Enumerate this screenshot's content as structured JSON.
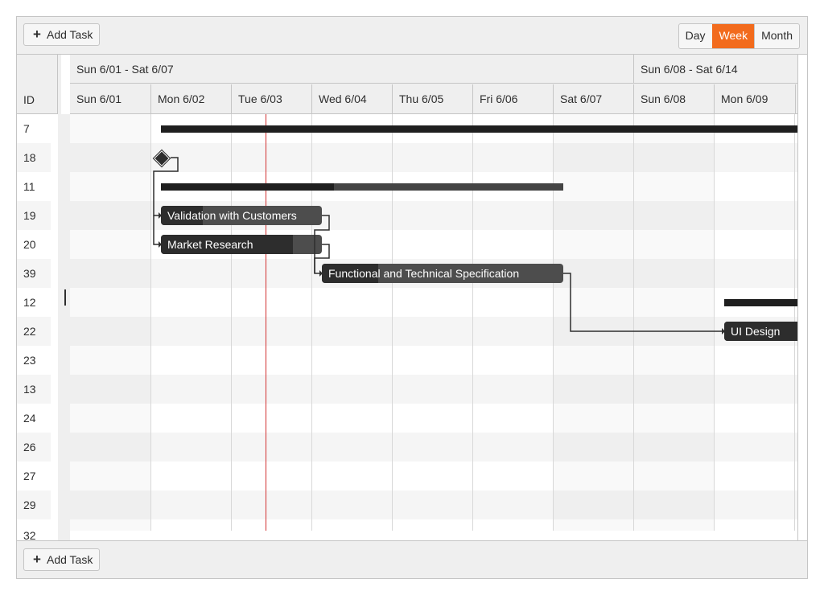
{
  "toolbar": {
    "add_task_label": "Add Task",
    "views": [
      "Day",
      "Week",
      "Month"
    ],
    "selected_view": "Week"
  },
  "list": {
    "header": "ID",
    "row_ids": [
      "7",
      "18",
      "11",
      "19",
      "20",
      "39",
      "12",
      "22",
      "23",
      "13",
      "24",
      "26",
      "27",
      "29",
      "32"
    ]
  },
  "timeline": {
    "weeks": [
      "Sun 6/01 - Sat 6/07",
      "Sun 6/08 - Sat 6/14"
    ],
    "days": [
      "Sun 6/01",
      "Mon 6/02",
      "Tue 6/03",
      "Wed 6/04",
      "Thu 6/05",
      "Fri 6/06",
      "Sat 6/07",
      "Sun 6/08",
      "Mon 6/09"
    ],
    "tasks": {
      "validation": "Validation with Customers",
      "market": "Market Research",
      "spec": "Functional and Technical Specification",
      "ui": "UI Design"
    }
  },
  "colors": {
    "accent": "#f26b1d",
    "today_line": "#d12f2f",
    "task_bar": "#4d4d4d"
  }
}
